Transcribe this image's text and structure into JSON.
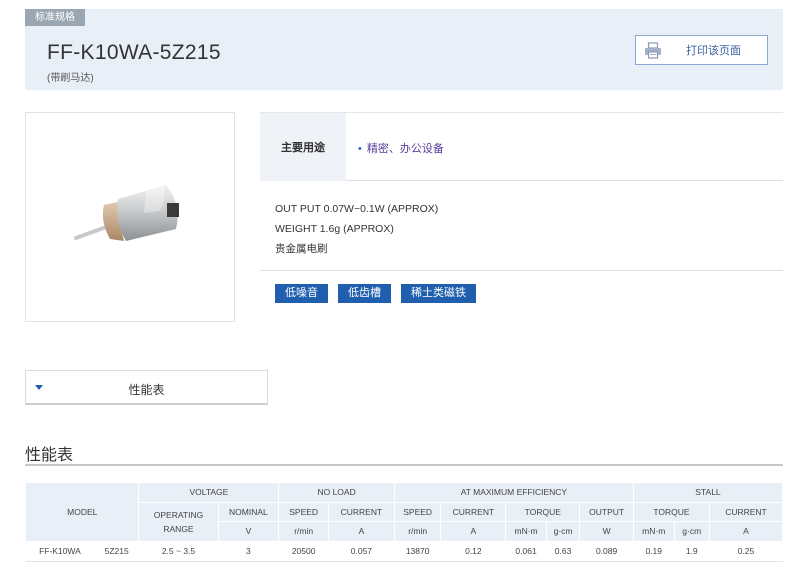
{
  "header": {
    "tag": "标准规格",
    "model": "FF-K10WA-5Z215",
    "subtitle": "(带刷马达)",
    "print_label": "打印该页面"
  },
  "usage": {
    "label": "主要用途",
    "value": "精密、办公设备"
  },
  "specs": {
    "output": "OUT PUT 0.07W~0.1W (APPROX)",
    "weight": "WEIGHT 1.6g (APPROX)",
    "brush": "贵金属电刷"
  },
  "tags": [
    "低噪音",
    "低齿槽",
    "稀土类磁铁"
  ],
  "perf_toggle_label": "性能表",
  "section_title": "性能表",
  "table": {
    "groups": {
      "model": "MODEL",
      "voltage": "VOLTAGE",
      "no_load": "NO LOAD",
      "max_eff": "AT MAXIMUM EFFICIENCY",
      "stall": "STALL"
    },
    "sub": {
      "operating_range": "OPERATING RANGE",
      "nominal": "NOMINAL",
      "speed": "SPEED",
      "current": "CURRENT",
      "torque": "TORQUE",
      "output": "OUTPUT"
    },
    "units": {
      "v": "V",
      "rmin": "r/min",
      "a": "A",
      "mnm": "mN·m",
      "gcm": "g·cm",
      "w": "W"
    },
    "row": {
      "model": "FF-K10WA",
      "variant": "5Z215",
      "range": "2.5 ~ 3.5",
      "nominal": "3",
      "nl_speed": "20500",
      "nl_current": "0.057",
      "me_speed": "13870",
      "me_current": "0.12",
      "me_torque_mnm": "0.061",
      "me_torque_gcm": "0.63",
      "me_output": "0.089",
      "st_torque_mnm": "0.19",
      "st_torque_gcm": "1.9",
      "st_current": "0.25"
    }
  },
  "colors": {
    "accent": "#1f5fae",
    "header_bg": "#e9eff7",
    "tag_gray": "#9aa6b2",
    "usage_text": "#5a3c9e"
  },
  "icons": {
    "print": "printer-icon",
    "caret": "caret-down-icon"
  }
}
